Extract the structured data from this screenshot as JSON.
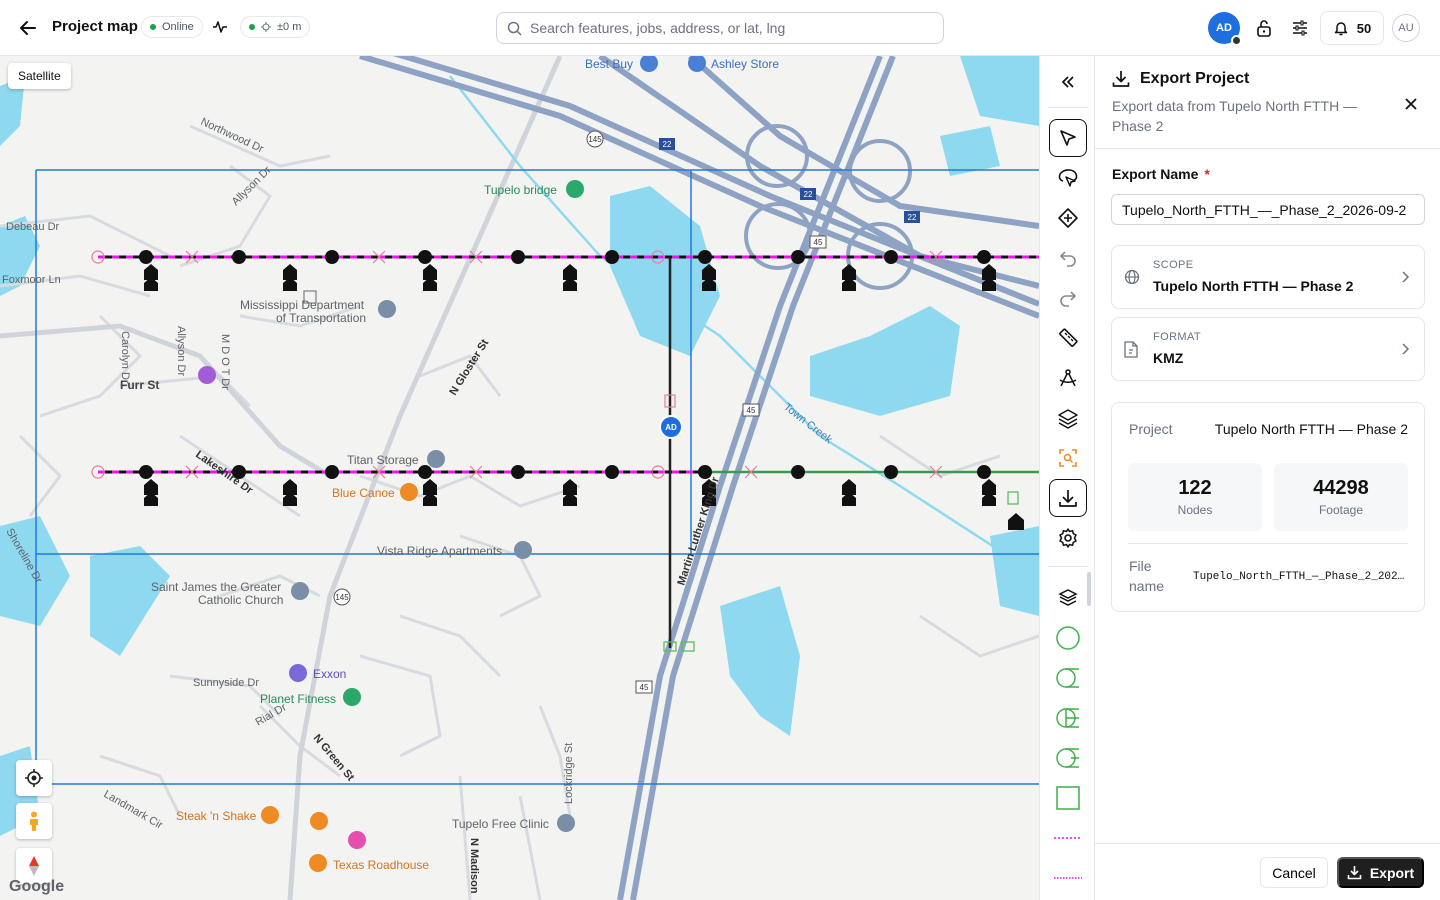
{
  "header": {
    "title": "Project map",
    "status_label": "Online",
    "accuracy_label": "±0 m",
    "search_placeholder": "Search features, jobs, address, or lat, lng",
    "user_initials": "AD",
    "notification_count": "50",
    "secondary_user": "AU"
  },
  "map": {
    "satellite_label": "Satellite",
    "google_label": "Google",
    "user_pin": "AD",
    "labels": [
      {
        "text": "Best Buy"
      },
      {
        "text": "Ashley Store"
      },
      {
        "text": "Northwood Dr"
      },
      {
        "text": "Allyson Dr"
      },
      {
        "text": "Tupelo bridge"
      },
      {
        "text": "Debeau Dr"
      },
      {
        "text": "Foxmoor Ln"
      },
      {
        "text": "Mississippi Department"
      },
      {
        "text": "of Transportation"
      },
      {
        "text": "Carolyn Dr"
      },
      {
        "text": "Allyson Dr"
      },
      {
        "text": "M D O T Dr"
      },
      {
        "text": "Furr St"
      },
      {
        "text": "N Gloster St"
      },
      {
        "text": "Titan Storage"
      },
      {
        "text": "Blue Canoe"
      },
      {
        "text": "Lakeshire Dr"
      },
      {
        "text": "Town Creek"
      },
      {
        "text": "Vista Ridge Apartments"
      },
      {
        "text": "Saint James the Greater"
      },
      {
        "text": "Catholic Church"
      },
      {
        "text": "Martin Luther King Dr"
      },
      {
        "text": "Exxon"
      },
      {
        "text": "Sunnyside Dr"
      },
      {
        "text": "Planet Fitness"
      },
      {
        "text": "Rial Dr"
      },
      {
        "text": "N Green St"
      },
      {
        "text": "Steak 'n Shake"
      },
      {
        "text": "Tupelo Free Clinic"
      },
      {
        "text": "Texas Roadhouse"
      },
      {
        "text": "Landmark Cir"
      },
      {
        "text": "Lockridge St"
      },
      {
        "text": "N Madison"
      },
      {
        "text": "Shoreline Dr"
      }
    ],
    "shields": [
      "145",
      "22",
      "22",
      "22",
      "45",
      "45",
      "145",
      "45"
    ]
  },
  "rail": {
    "tools": [
      {
        "name": "select-tool",
        "active": true
      },
      {
        "name": "lasso-tool",
        "active": false
      },
      {
        "name": "add-node-tool",
        "active": false
      },
      {
        "name": "undo-tool",
        "active": false
      },
      {
        "name": "redo-tool",
        "active": false
      },
      {
        "name": "measure-tool",
        "active": false
      },
      {
        "name": "draw-tool",
        "active": false
      },
      {
        "name": "layers-tool",
        "active": false
      },
      {
        "name": "scan-tool",
        "active": false
      },
      {
        "name": "export-tool",
        "active": true
      },
      {
        "name": "settings-tool",
        "active": false
      }
    ]
  },
  "panel": {
    "title": "Export Project",
    "subtitle": "Export data from Tupelo North FTTH — Phase 2",
    "name_label": "Export Name",
    "name_required": "*",
    "name_value": "Tupelo_North_FTTH_—_Phase_2_2026-09-2",
    "scope_caption": "SCOPE",
    "scope_value": "Tupelo North FTTH — Phase 2",
    "format_caption": "FORMAT",
    "format_value": "KMZ",
    "summary": {
      "project_label": "Project",
      "project_value": "Tupelo North FTTH — Phase 2",
      "nodes_value": "122",
      "nodes_label": "Nodes",
      "footage_value": "44298",
      "footage_label": "Footage",
      "file_label": "File name",
      "file_value": "Tupelo_North_FTTH_—_Phase_2_202…"
    },
    "cancel_label": "Cancel",
    "export_label": "Export"
  },
  "colors": {
    "accent": "#1d6fe0",
    "online": "#16a34a",
    "required": "#dc2626",
    "primary_button": "#1f1f1f",
    "fiber_magenta": "#e619e6",
    "grid_blue": "#1f7ae0",
    "water": "#8fd9f0",
    "highway": "#8ea3c4"
  }
}
